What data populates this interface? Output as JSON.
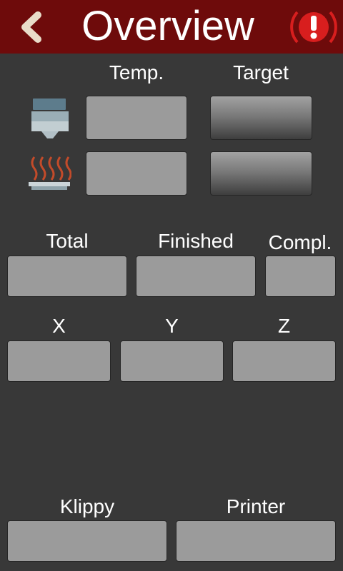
{
  "header": {
    "title": "Overview",
    "back_icon": "chevron-left-icon",
    "alert_icon": "alert-exclamation-icon",
    "accent_color": "#6e0b0b",
    "alert_color": "#d81e1e"
  },
  "temperatures": {
    "col_temp": "Temp.",
    "col_target": "Target",
    "rows": [
      {
        "icon": "extruder-icon",
        "temp": "",
        "target": ""
      },
      {
        "icon": "heated-bed-icon",
        "temp": "",
        "target": ""
      }
    ]
  },
  "job": {
    "total_label": "Total",
    "finished_label": "Finished",
    "completion_label": "Compl.",
    "total": "",
    "finished": "",
    "completion": ""
  },
  "position": {
    "x_label": "X",
    "y_label": "Y",
    "z_label": "Z",
    "x": "",
    "y": "",
    "z": ""
  },
  "status": {
    "klippy_label": "Klippy",
    "printer_label": "Printer",
    "klippy": "",
    "printer": ""
  }
}
